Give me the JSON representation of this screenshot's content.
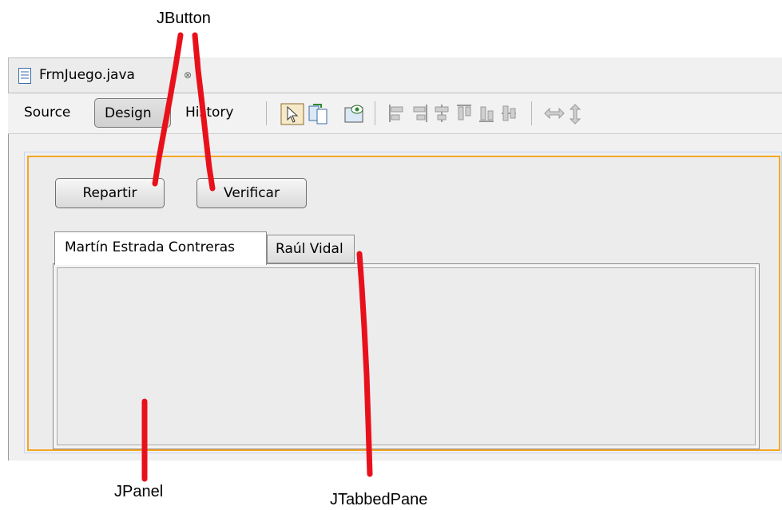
{
  "editor": {
    "file_tab_label": "FrmJuego.java",
    "close_glyph": "⊗"
  },
  "toolbar": {
    "source_label": "Source",
    "design_label": "Design",
    "history_label": "History"
  },
  "form": {
    "buttons": [
      {
        "label": "Repartir"
      },
      {
        "label": "Verificar"
      }
    ],
    "tabs": [
      {
        "label": "Martín Estrada Contreras",
        "selected": true
      },
      {
        "label": "Raúl Vidal",
        "selected": false
      }
    ]
  },
  "annotations": {
    "jbutton": "JButton",
    "jpanel": "JPanel",
    "jtabbedpane": "JTabbedPane",
    "line_color": "#e8111b"
  },
  "colors": {
    "selection_border": "#f5a623",
    "annotation_red": "#e8111b"
  }
}
